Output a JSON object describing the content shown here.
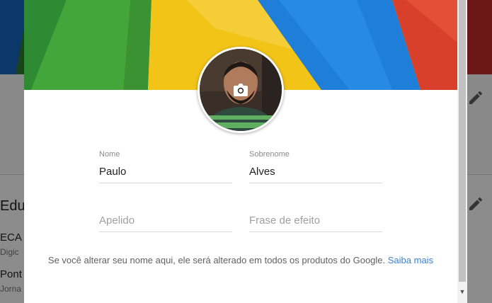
{
  "background": {
    "section_heading": "Edu",
    "items": [
      {
        "title": "ECA",
        "subtitle": "Digic"
      },
      {
        "title": "Pont",
        "subtitle": "Jorna"
      }
    ]
  },
  "dialog": {
    "first_name": {
      "label": "Nome",
      "value": "Paulo"
    },
    "last_name": {
      "label": "Sobrenome",
      "value": "Alves"
    },
    "nickname": {
      "placeholder": "Apelido"
    },
    "tagline": {
      "placeholder": "Frase de efeito"
    },
    "notice_text": "Se você alterar seu nome aqui, ele será alterado em todos os produtos do Google.",
    "notice_link": "Saiba mais"
  },
  "icons": {
    "camera": "camera-icon",
    "edit": "pencil-icon",
    "scroll": "scroll-down-arrow-icon"
  },
  "colors": {
    "link": "#3b82d6",
    "overlay": "rgba(0,0,0,0.45)"
  }
}
